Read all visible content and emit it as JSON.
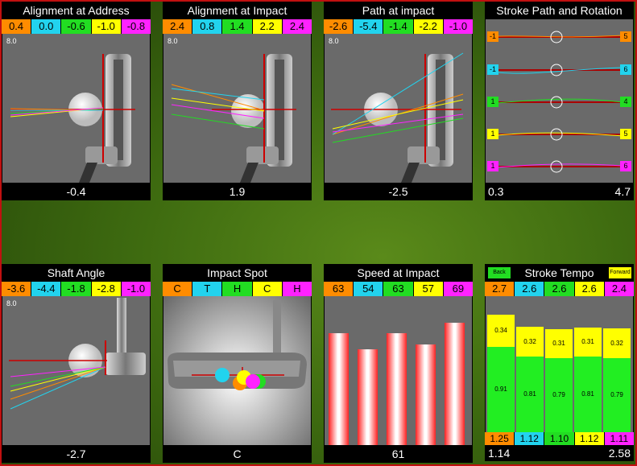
{
  "panels": {
    "addr": {
      "title": "Alignment at Address",
      "values": [
        "0.4",
        "0.0",
        "-0.6",
        "-1.0",
        "-0.8"
      ],
      "scale": "8.0",
      "result": "-0.4"
    },
    "aimp": {
      "title": "Alignment at Impact",
      "values": [
        "2.4",
        "0.8",
        "1.4",
        "2.2",
        "2.4"
      ],
      "scale": "8.0",
      "result": "1.9"
    },
    "path": {
      "title": "Path at impact",
      "values": [
        "-2.6",
        "-5.4",
        "-1.4",
        "-2.2",
        "-1.0"
      ],
      "scale": "8.0",
      "result": "-2.5"
    },
    "rot": {
      "title": "Stroke Path and Rotation",
      "left": [
        "-1",
        "-1",
        "1",
        "1",
        "1"
      ],
      "right": [
        "5",
        "6",
        "4",
        "5",
        "6"
      ],
      "result_left": "0.3",
      "result_right": "4.7"
    },
    "shaft": {
      "title": "Shaft Angle",
      "values": [
        "-3.6",
        "-4.4",
        "-1.8",
        "-2.8",
        "-1.0"
      ],
      "scale": "8.0",
      "result": "-2.7"
    },
    "spot": {
      "title": "Impact Spot",
      "values": [
        "C",
        "T",
        "H",
        "C",
        "H"
      ],
      "result": "C"
    },
    "speed": {
      "title": "Speed at Impact",
      "values": [
        "63",
        "54",
        "63",
        "57",
        "69"
      ],
      "result": "61",
      "bars": [
        63,
        54,
        63,
        57,
        69
      ],
      "bar_max": 75
    },
    "tempo": {
      "title": "Stroke Tempo",
      "back_label": "Back",
      "forward_label": "Forward",
      "values": [
        "2.7",
        "2.6",
        "2.6",
        "2.6",
        "2.4"
      ],
      "back": [
        "0.34",
        "0.32",
        "0.31",
        "0.31",
        "0.32"
      ],
      "forward": [
        "0.91",
        "0.81",
        "0.79",
        "0.81",
        "0.79"
      ],
      "bottom": [
        "1.25",
        "1.12",
        "1.10",
        "1.12",
        "1.11"
      ],
      "result_left": "1.14",
      "result_right": "2.58"
    }
  },
  "colors": {
    "orange": "#ff8c00",
    "cyan": "#22d3ee",
    "green": "#22dd22",
    "yellow": "#ffff00",
    "magenta": "#ff22ff",
    "red": "#cc0000"
  }
}
